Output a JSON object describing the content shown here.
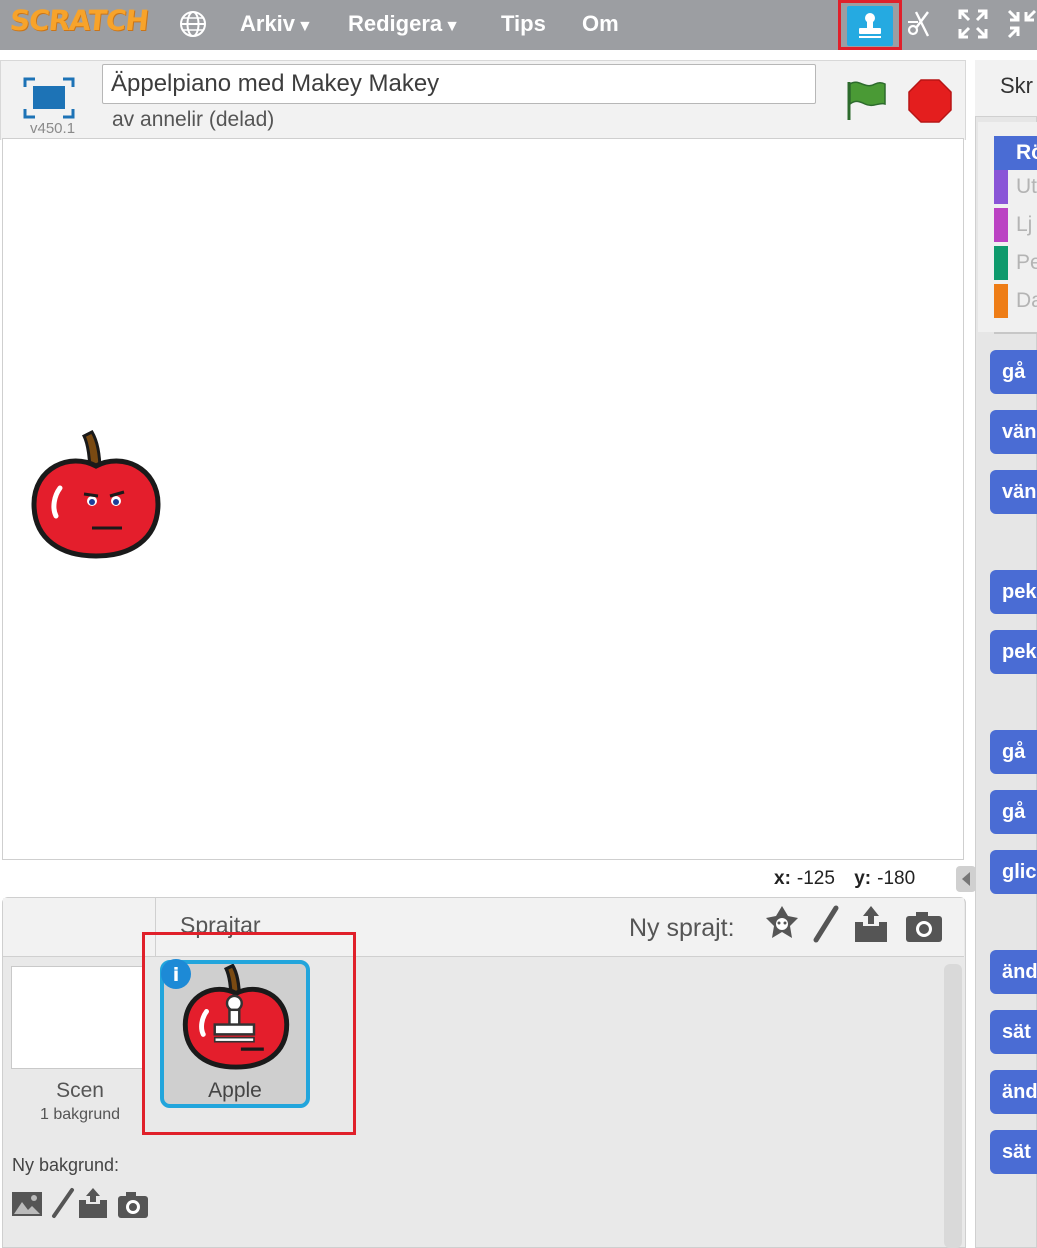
{
  "app": {
    "logo_text": "SCRATCH"
  },
  "menu": {
    "items": [
      {
        "label": "Arkiv",
        "has_dropdown": true
      },
      {
        "label": "Redigera",
        "has_dropdown": true
      },
      {
        "label": "Tips",
        "has_dropdown": false
      },
      {
        "label": "Om",
        "has_dropdown": false
      }
    ],
    "dropdown_glyph": "▼",
    "tools": [
      "stamp-icon",
      "scissors-icon",
      "grow-icon",
      "shrink-icon"
    ]
  },
  "project": {
    "title": "Äppelpiano med Makey Makey",
    "author": "av annelir (delad)",
    "version": "v450.1"
  },
  "stage": {
    "coords": {
      "x_label": "x:",
      "x_value": "-125",
      "y_label": "y:",
      "y_value": "-180"
    }
  },
  "sprites": {
    "title": "Sprajtar",
    "new_sprite_label": "Ny sprajt:",
    "new_sprite_tools": [
      "library-sprite-icon",
      "paint-brush-icon",
      "upload-icon",
      "camera-icon"
    ],
    "list": [
      {
        "name": "Apple",
        "selected": true
      }
    ],
    "info_glyph": "i"
  },
  "scene": {
    "label": "Scen",
    "backdrop_count": "1 bakgrund",
    "new_backdrop_label": "Ny bakgrund:"
  },
  "palette": {
    "tab_label": "Skr",
    "categories": [
      {
        "label": "Rö",
        "color": "#4a6cd4",
        "active": true
      },
      {
        "label": "Ut",
        "color": "#8a55d7",
        "active": false
      },
      {
        "label": "Lj",
        "color": "#bb42c3",
        "active": false
      },
      {
        "label": "Pe",
        "color": "#0e9a6c",
        "active": false
      },
      {
        "label": "Da",
        "color": "#ee7d16",
        "active": false
      }
    ],
    "blocks": [
      "gå",
      "vän",
      "vän",
      "pek",
      "pek",
      "gå",
      "gå",
      "glic",
      "änd",
      "sät",
      "änd",
      "sät"
    ]
  },
  "colors": {
    "topbar": "#9c9ea2",
    "accent": "#25aae1",
    "highlight": "#e0202a",
    "motion_block": "#4a6cd4"
  }
}
